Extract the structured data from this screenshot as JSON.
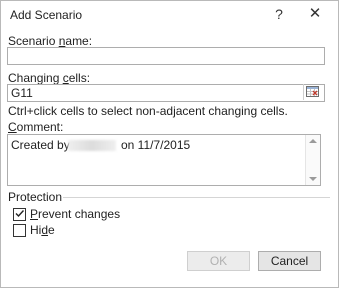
{
  "window": {
    "title": "Add Scenario",
    "help_glyph": "?",
    "close_glyph": "✕"
  },
  "scenario_name": {
    "label_prefix": "Scenario ",
    "label_access": "n",
    "label_rest": "ame:",
    "value": ""
  },
  "changing_cells": {
    "label_prefix": "Changing ",
    "label_access": "c",
    "label_rest": "ells:",
    "value": "G11",
    "ref_icon": "range-select-icon"
  },
  "hint": "Ctrl+click cells to select non-adjacent changing cells.",
  "comment": {
    "label_prefix": "",
    "label_access": "C",
    "label_rest": "omment:",
    "text_start": "Created by",
    "text_end": "on 11/7/2015"
  },
  "protection": {
    "group_label": "Protection",
    "prevent": {
      "label_access": "P",
      "label_rest": "revent changes",
      "checked": true
    },
    "hide": {
      "label_prefix": "Hi",
      "label_access": "d",
      "label_rest": "e",
      "checked": false
    }
  },
  "buttons": {
    "ok": "OK",
    "cancel": "Cancel"
  }
}
